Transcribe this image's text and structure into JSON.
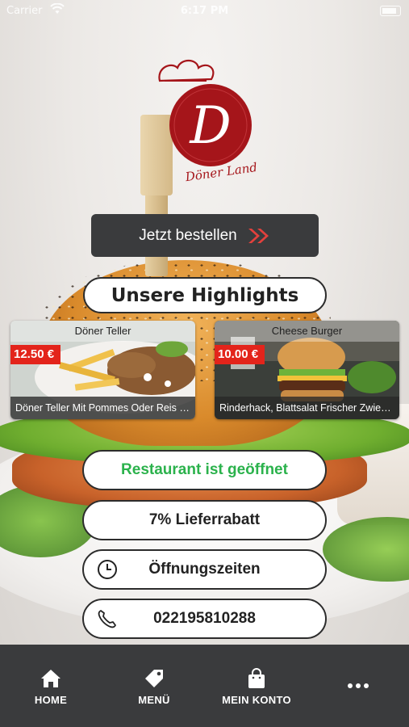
{
  "status_bar": {
    "carrier": "Carrier",
    "time": "6:17 PM"
  },
  "logo": {
    "letter": "D",
    "name": "Döner Land"
  },
  "order_button": {
    "label": "Jetzt bestellen"
  },
  "highlights": {
    "title": "Unsere Highlights",
    "items": [
      {
        "title": "Döner Teller",
        "price": "12.50 €",
        "description": "Döner Teller Mit Pommes Oder Reis Und ..."
      },
      {
        "title": "Cheese Burger",
        "price": "10.00 €",
        "description": "Rinderhack, Blattsalat Frischer Zwiebelr..."
      }
    ]
  },
  "info": {
    "status": "Restaurant ist geöffnet",
    "discount": "7% Lieferrabatt",
    "hours": "Öffnungszeiten",
    "phone": "022195810288"
  },
  "tabs": [
    {
      "label": "HOME",
      "icon": "home-icon"
    },
    {
      "label": "MENÜ",
      "icon": "tag-icon"
    },
    {
      "label": "MEIN KONTO",
      "icon": "bag-icon"
    },
    {
      "label": "",
      "icon": "more-icon"
    }
  ],
  "colors": {
    "accent_red": "#e3241b",
    "open_green": "#2bb24c",
    "dark_bar": "#3a3b3d",
    "logo_red": "#a5151a"
  }
}
